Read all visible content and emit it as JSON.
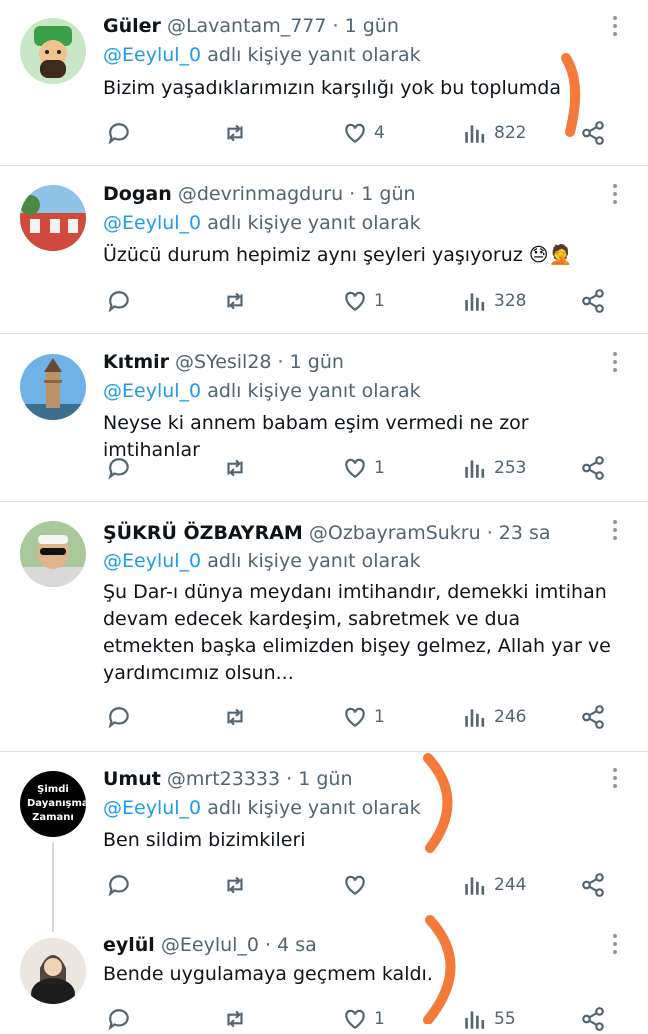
{
  "reply_prefix": "adlı kişiye yanıt olarak",
  "tweets": [
    {
      "name": "Güler",
      "handle": "@Lavantam_777",
      "time": "1 gün",
      "mention": "@Eeylul_0",
      "text": "Bizim yaşadıklarımızın karşılığı yok bu toplumda",
      "likes": "4",
      "views": "822"
    },
    {
      "name": "Dogan",
      "handle": "@devrinmagduru",
      "time": "1 gün",
      "mention": "@Eeylul_0",
      "text": "Üzücü durum hepimiz aynı şeyleri yaşıyoruz 😓🤦",
      "likes": "1",
      "views": "328"
    },
    {
      "name": "Kıtmir",
      "handle": "@SYesil28",
      "time": "1 gün",
      "mention": "@Eeylul_0",
      "text": "Neyse ki annem babam eşim vermedi ne zor imtihanlar",
      "likes": "1",
      "views": "253"
    },
    {
      "name": "ŞÜKRÜ ÖZBAYRAM",
      "handle": "@OzbayramSukru",
      "time": "23 sa",
      "mention": "@Eeylul_0",
      "text": "Şu Dar-ı dünya meydanı imtihandır, demekki imtihan devam edecek kardeşim, sabretmek ve dua etmekten başka elimizden bişey gelmez, Allah yar ve yardımcımız olsun...",
      "likes": "1",
      "views": "246"
    },
    {
      "name": "Umut",
      "handle": "@mrt23333",
      "time": "1 gün",
      "mention": "@Eeylul_0",
      "text": "Ben sildim bizimkileri",
      "likes": "",
      "views": "244",
      "avatar_text": "Şimdi Dayanışma Zamanı"
    },
    {
      "name": "eylül",
      "handle": "@Eeylul_0",
      "time": "4 sa",
      "text": "Bende uygulamaya geçmem kaldı.",
      "likes": "1",
      "views": "55"
    }
  ],
  "colors": {
    "accent": "#1d9bf0",
    "muted": "#536471",
    "annotation": "#f47a3a"
  }
}
